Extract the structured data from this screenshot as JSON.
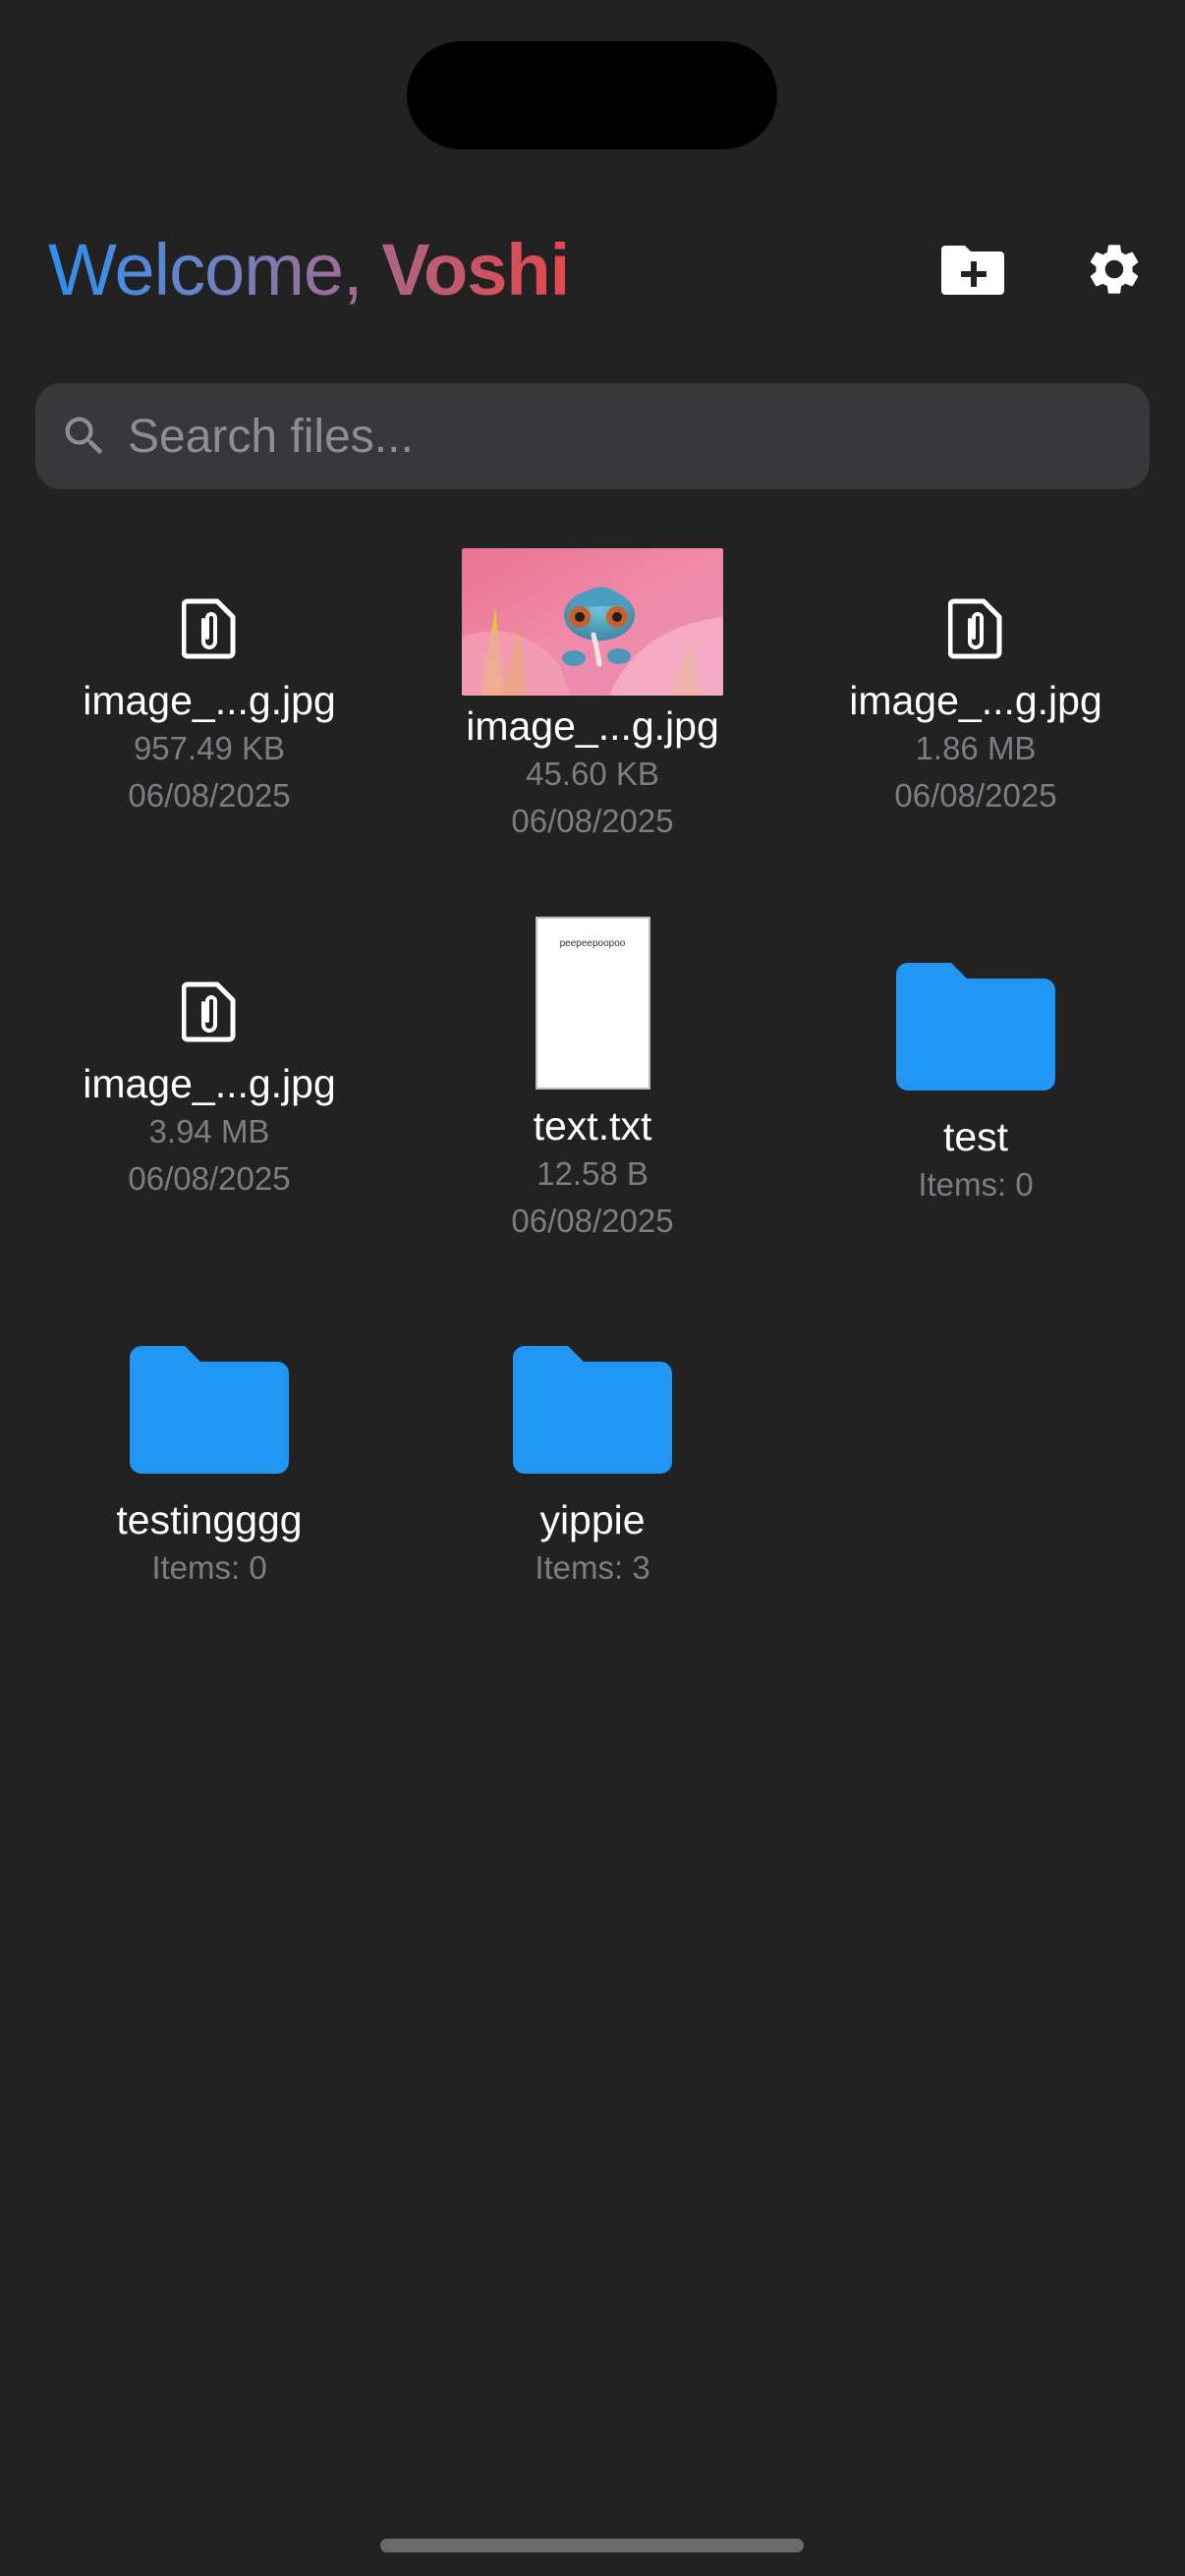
{
  "header": {
    "greeting": "Welcome, ",
    "user_name": "Voshi",
    "new_folder_icon": "create-new-folder-icon",
    "settings_icon": "gear-icon"
  },
  "search": {
    "placeholder": "Search files...",
    "value": "",
    "icon": "search-icon"
  },
  "items": [
    {
      "type": "file",
      "name": "image_...g.jpg",
      "size": "957.49 KB",
      "date": "06/08/2025",
      "icon": "attachment-file-icon"
    },
    {
      "type": "image",
      "name": "image_...g.jpg",
      "size": "45.60 KB",
      "date": "06/08/2025",
      "thumbnail": "chameleon-on-flower-thumbnail"
    },
    {
      "type": "file",
      "name": "image_...g.jpg",
      "size": "1.86 MB",
      "date": "06/08/2025",
      "icon": "attachment-file-icon"
    },
    {
      "type": "file",
      "name": "image_...g.jpg",
      "size": "3.94 MB",
      "date": "06/08/2025",
      "icon": "attachment-file-icon"
    },
    {
      "type": "text",
      "name": "text.txt",
      "size": "12.58 B",
      "date": "06/08/2025",
      "preview_text": "peepeepoopoo"
    },
    {
      "type": "folder",
      "name": "test",
      "items_label": "Items: 0",
      "icon": "folder-icon"
    },
    {
      "type": "folder",
      "name": "testingggg",
      "items_label": "Items: 0",
      "icon": "folder-icon"
    },
    {
      "type": "folder",
      "name": "yippie",
      "items_label": "Items: 3",
      "icon": "folder-icon"
    }
  ],
  "colors": {
    "background": "#222223",
    "search_background": "#38383a",
    "folder_blue": "#2196f3",
    "greeting_gradient_start": "#2e8ff0",
    "greeting_gradient_end": "#e8474e",
    "meta_text": "#7e7e82"
  }
}
